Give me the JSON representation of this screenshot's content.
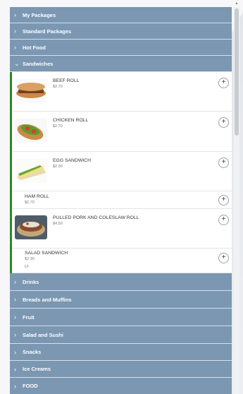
{
  "categories_top": [
    {
      "label": "My Packages",
      "chevron": "›"
    },
    {
      "label": "Standard Packages",
      "chevron": "›"
    },
    {
      "label": "Hot Food",
      "chevron": "›"
    }
  ],
  "expanded": {
    "label": "Sandwiches",
    "chevron": "⌄"
  },
  "items": [
    {
      "name": "BEEF ROLL",
      "price": "$2.70",
      "add": "+",
      "image": "beef-roll-image"
    },
    {
      "name": "CHICKEN ROLL",
      "price": "$2.70",
      "add": "+",
      "image": "chicken-roll-image"
    },
    {
      "name": "EGG SANDWICH",
      "price": "$2.30",
      "add": "+",
      "image": "egg-sandwich-image"
    },
    {
      "name": "HAM ROLL",
      "price": "$2.70",
      "add": "+"
    },
    {
      "name": "PULLED PORK AND COLESLAW ROLL",
      "price": "$4.50",
      "add": "+",
      "image": "pulled-pork-roll-image"
    },
    {
      "name": "SALAD SANDWICH",
      "price": "$2.30",
      "tag": "LF",
      "add": "+"
    }
  ],
  "categories_bottom": [
    {
      "label": "Drinks",
      "chevron": "›"
    },
    {
      "label": "Breads and Muffins",
      "chevron": "›"
    },
    {
      "label": "Fruit",
      "chevron": "›"
    },
    {
      "label": "Salad and Sushi",
      "chevron": "›"
    },
    {
      "label": "Snacks",
      "chevron": "›"
    },
    {
      "label": "Ice Creams",
      "chevron": "›"
    },
    {
      "label": "FOOD",
      "chevron": "›"
    }
  ],
  "colors": {
    "category_bg": "#7b97b2",
    "selected_bar": "#1f8f1f"
  }
}
